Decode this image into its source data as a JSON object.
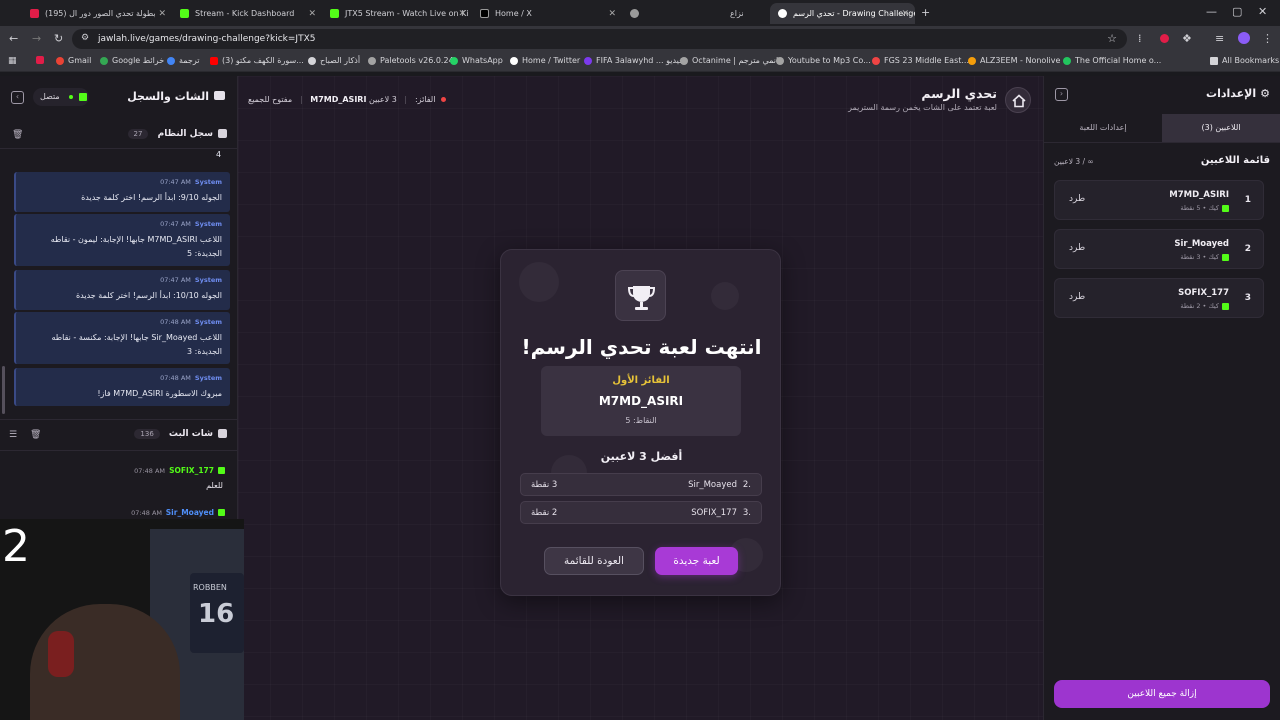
{
  "browser": {
    "tabs": [
      {
        "title": "بطولة تحدي الصور دور ال (195)",
        "color": "#e11d48"
      },
      {
        "title": "Stream - Kick Dashboard",
        "color": "#53fc18"
      },
      {
        "title": "JTX5 Stream - Watch Live on Ki",
        "color": "#53fc18"
      },
      {
        "title": "Home / X",
        "color": "#ffffff"
      },
      {
        "title": "",
        "color": "#9a9a9a"
      },
      {
        "title": "نزاع",
        "color": "#d4d4d8"
      },
      {
        "title": "تحدي الرسم - Drawing Challenge",
        "color": "#ffffff"
      }
    ],
    "url": "jawlah.live/games/drawing-challenge?kick=JTX5",
    "bookmarks": [
      {
        "label": "Gmail",
        "color": "#ea4335"
      },
      {
        "label": "Google خرائط",
        "color": "#34a853"
      },
      {
        "label": "ترجمة",
        "color": "#4285f4"
      },
      {
        "label": "(3) سورة الكهف مكتو...",
        "color": "#ff0000"
      },
      {
        "label": "أذكار الصباح",
        "color": "#d4d4d8"
      },
      {
        "label": "Paletools v26.0.24",
        "color": "#a3a3a3"
      },
      {
        "label": "WhatsApp",
        "color": "#25d366"
      },
      {
        "label": "Home / Twitter",
        "color": "#ffffff"
      },
      {
        "label": "FIFA 3alawyhd ... فيديو",
        "color": "#7c3aed"
      },
      {
        "label": "Octanime | انمي مترجم",
        "color": "#a3a3a3"
      },
      {
        "label": "Youtube to Mp3 Co...",
        "color": "#a3a3a3"
      },
      {
        "label": "FGS 23 Middle East...",
        "color": "#ef4444"
      },
      {
        "label": "ALZ3EEM - Nonolive",
        "color": "#f59e0b"
      },
      {
        "label": "The Official Home o...",
        "color": "#22c55e"
      }
    ],
    "all_bookmarks": "All Bookmarks"
  },
  "left": {
    "title": "الشات والسجل",
    "status": "متصل",
    "system_log": {
      "title": "سجل النظام",
      "count": "27",
      "top_fragment": "4"
    },
    "messages": [
      {
        "author": "System",
        "time": "07:47 AM",
        "text": "الجوله 9/10: ابدأ الرسم! اختر كلمة جديدة"
      },
      {
        "author": "System",
        "time": "07:47 AM",
        "text": "اللاعب M7MD_ASIRI جابها! الإجابة: ليمون - نقاطه الجديدة: 5"
      },
      {
        "author": "System",
        "time": "07:47 AM",
        "text": "الجوله 10/10: ابدأ الرسم! اختر كلمة جديدة"
      },
      {
        "author": "System",
        "time": "07:48 AM",
        "text": "اللاعب Sir_Moayed جابها! الإجابة: مكنسة - نقاطه الجديدة: 3"
      },
      {
        "author": "System",
        "time": "07:48 AM",
        "text": "مبروك الاسطورة M7MD_ASIRI فاز!"
      }
    ],
    "stream_chat": {
      "title": "شات البث",
      "count": "136"
    },
    "chat_messages": [
      {
        "author": "SOFIX_177",
        "time": "07:48 AM",
        "text": "للعلم",
        "color": "#53fc18"
      },
      {
        "author": "Sir_Moayed",
        "time": "07:48 AM",
        "text": "",
        "color": "#4f8ef7"
      }
    ]
  },
  "header": {
    "title": "تحدي الرسم",
    "subtitle": "لعبة تعتمد على الشات يخمن رسمة الستريمر",
    "players_count": "3 لاعبين",
    "winner_label": "الفائز:",
    "winner_name": "M7MD_ASIRI",
    "open_label": "مفتوح للجميع"
  },
  "modal": {
    "title": "انتهت لعبة تحدي الرسم!",
    "first_label": "الفائز الأول",
    "winner": "M7MD_ASIRI",
    "winner_points": "النقاط: 5",
    "top_title": "أفضل 3 لاعبين",
    "top": [
      {
        "rank": "2.",
        "name": "Sir_Moayed",
        "points": "3 نقطة"
      },
      {
        "rank": "3.",
        "name": "SOFIX_177",
        "points": "2 نقطة"
      }
    ],
    "new_game": "لعبة جديدة",
    "back": "العودة للقائمة"
  },
  "right": {
    "title": "الإعدادات",
    "tab_players": "اللاعبين (3)",
    "tab_settings": "إعدادات اللعبة",
    "list_title": "قائمة اللاعبين",
    "list_count": "∞ / 3 لاعبين",
    "kick_label": "طرد",
    "players": [
      {
        "rank": "1",
        "name": "M7MD_ASIRI",
        "sub": "كيك • 5 نقطة"
      },
      {
        "rank": "2",
        "name": "Sir_Moayed",
        "sub": "كيك • 3 نقطة"
      },
      {
        "rank": "3",
        "name": "SOFIX_177",
        "sub": "كيك • 2 نقطة"
      }
    ],
    "remove_all": "إزالة جميع اللاعبين"
  },
  "overlay": {
    "number": "2",
    "jersey": "ROBBEN",
    "jersey_number": "16"
  },
  "colors": {
    "accent": "#a83ad6",
    "gold": "#e7c338",
    "kick": "#53fc18",
    "system": "#6f8df0"
  }
}
